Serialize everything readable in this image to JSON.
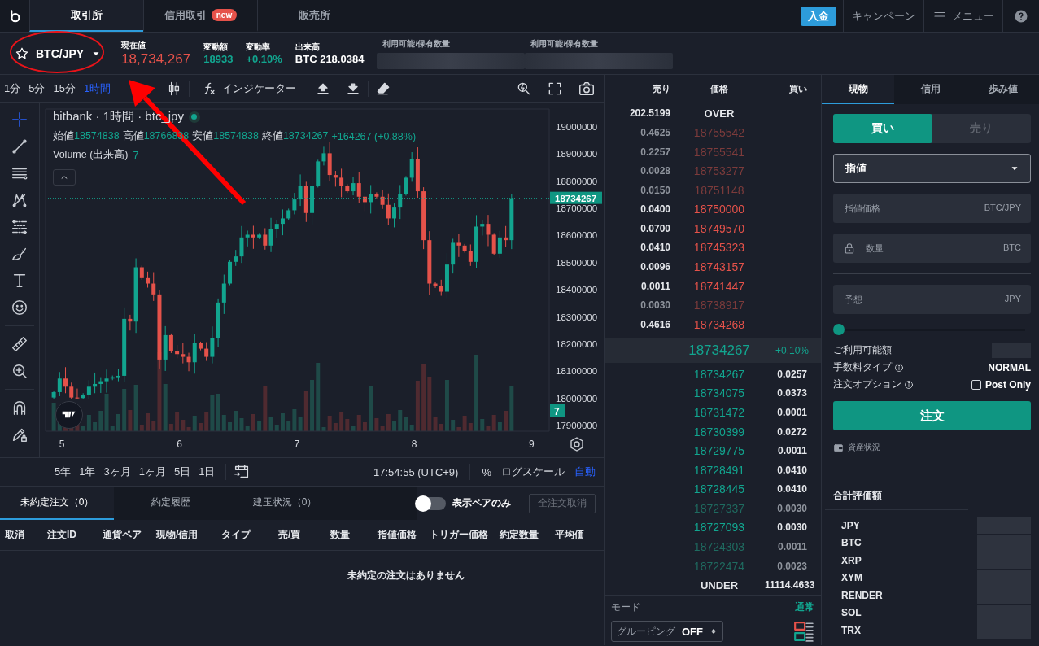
{
  "nav": {
    "tabs": [
      {
        "label": "取引所",
        "selected": true
      },
      {
        "label": "信用取引",
        "badge": "new",
        "selected": false
      },
      {
        "label": "販売所",
        "selected": false
      }
    ],
    "deposit_button": "入金",
    "campaign_link": "キャンペーン",
    "menu_link": "メニュー"
  },
  "ticker": {
    "pair": "BTC/JPY",
    "favorite": false,
    "stats": [
      {
        "label": "現在値",
        "value": "18,734,267",
        "kind": "price"
      },
      {
        "label": "変動額",
        "value": "18933",
        "kind": "up"
      },
      {
        "label": "変動率",
        "value": "+0.10%",
        "kind": "up"
      },
      {
        "label": "出来高",
        "value": "BTC 218.0384",
        "kind": "plain"
      }
    ],
    "balances": [
      "利用可能/保有数量",
      "利用可能/保有数量"
    ]
  },
  "chart": {
    "intervals": [
      {
        "label": "1分",
        "selected": false
      },
      {
        "label": "5分",
        "selected": false
      },
      {
        "label": "15分",
        "selected": false
      },
      {
        "label": "1時間",
        "selected": true
      }
    ],
    "indicator_button": "インジケーター",
    "title": "bitbank · 1時間 · btc_jpy",
    "ohlc": [
      {
        "label": "始値",
        "value": "18574838"
      },
      {
        "label": "高値",
        "value": "18766838"
      },
      {
        "label": "安値",
        "value": "18574838"
      },
      {
        "label": "終値",
        "value": "18734267"
      }
    ],
    "change": "+164267 (+0.88%)",
    "volume_label": "Volume (出来高)",
    "volume_value": "7",
    "chart_data": {
      "type": "candlestick",
      "ylim": [
        17876000,
        19063000
      ],
      "xlim": [
        4.86,
        9.15
      ],
      "ref_lines": [
        {
          "axis": "y",
          "value": 18734267
        }
      ],
      "yticks": [
        19000000,
        18900000,
        18800000,
        18700000,
        18600000,
        18500000,
        18400000,
        18300000,
        18200000,
        18100000,
        18000000,
        17900000
      ],
      "xticks": [
        5,
        6,
        7,
        8,
        9
      ],
      "x": [
        4.93,
        4.98,
        5.03,
        5.08,
        5.13,
        5.18,
        5.23,
        5.28,
        5.33,
        5.38,
        5.43,
        5.48,
        5.53,
        5.58,
        5.63,
        5.68,
        5.73,
        5.78,
        5.83,
        5.88,
        5.93,
        5.98,
        6.03,
        6.08,
        6.13,
        6.18,
        6.23,
        6.28,
        6.33,
        6.38,
        6.43,
        6.48,
        6.53,
        6.58,
        6.63,
        6.68,
        6.73,
        6.78,
        6.83,
        6.88,
        6.93,
        6.98,
        7.03,
        7.08,
        7.13,
        7.18,
        7.23,
        7.28,
        7.33,
        7.38,
        7.43,
        7.48,
        7.53,
        7.58,
        7.63,
        7.68,
        7.73,
        7.78,
        7.83,
        7.88,
        7.93,
        7.98,
        8.03,
        8.08,
        8.13,
        8.18,
        8.23,
        8.28,
        8.33,
        8.38,
        8.43,
        8.48,
        8.53,
        8.58,
        8.63,
        8.68,
        8.73,
        8.78,
        8.83
      ],
      "ohlc": [
        [
          18000000,
          18026000,
          17996000,
          18020000
        ],
        [
          18020000,
          18094000,
          18005000,
          18070000
        ],
        [
          18070000,
          18112000,
          18016000,
          18040000
        ],
        [
          18040000,
          18055000,
          17996000,
          18000000
        ],
        [
          18000000,
          18033000,
          17996000,
          17998000
        ],
        [
          17998000,
          18016000,
          17996000,
          18010000
        ],
        [
          18010000,
          18064000,
          17995000,
          18040000
        ],
        [
          18040000,
          18092000,
          18016000,
          18050000
        ],
        [
          18050000,
          18075000,
          18017000,
          18060000
        ],
        [
          18060000,
          18103000,
          18018000,
          18070000
        ],
        [
          18070000,
          18081000,
          18064000,
          18075000
        ],
        [
          18075000,
          18104000,
          18060000,
          18080000
        ],
        [
          18080000,
          18332000,
          18056000,
          18290000
        ],
        [
          18290000,
          18305000,
          18247000,
          18280000
        ],
        [
          18280000,
          18513000,
          18238000,
          18480000
        ],
        [
          18480000,
          18486000,
          18434000,
          18440000
        ],
        [
          18440000,
          18464000,
          18405000,
          18420000
        ],
        [
          18420000,
          18462000,
          18356000,
          18380000
        ],
        [
          18380000,
          18395000,
          18107000,
          18140000
        ],
        [
          18140000,
          18263000,
          18098000,
          18230000
        ],
        [
          18230000,
          18236000,
          18164000,
          18170000
        ],
        [
          18170000,
          18194000,
          18145000,
          18160000
        ],
        [
          18160000,
          18202000,
          18126000,
          18150000
        ],
        [
          18150000,
          18165000,
          18097000,
          18130000
        ],
        [
          18130000,
          18233000,
          18088000,
          18200000
        ],
        [
          18200000,
          18206000,
          18174000,
          18180000
        ],
        [
          18180000,
          18204000,
          18135000,
          18150000
        ],
        [
          18150000,
          18262000,
          18126000,
          18220000
        ],
        [
          18220000,
          18365000,
          18187000,
          18350000
        ],
        [
          18350000,
          18453000,
          18308000,
          18420000
        ],
        [
          18420000,
          18506000,
          18414000,
          18500000
        ],
        [
          18500000,
          18544000,
          18485000,
          18520000
        ],
        [
          18520000,
          18632000,
          18496000,
          18590000
        ],
        [
          18590000,
          18615000,
          18557000,
          18600000
        ],
        [
          18600000,
          18633000,
          18548000,
          18590000
        ],
        [
          18590000,
          18606000,
          18584000,
          18600000
        ],
        [
          18600000,
          18624000,
          18545000,
          18560000
        ],
        [
          18560000,
          18662000,
          18536000,
          18620000
        ],
        [
          18620000,
          18655000,
          18587000,
          18640000
        ],
        [
          18640000,
          18693000,
          18598000,
          18660000
        ],
        [
          18660000,
          18696000,
          18654000,
          18690000
        ],
        [
          18690000,
          18754000,
          18675000,
          18730000
        ],
        [
          18730000,
          18822000,
          18706000,
          18780000
        ],
        [
          18780000,
          18795000,
          18647000,
          18680000
        ],
        [
          18680000,
          18813000,
          18638000,
          18780000
        ],
        [
          18780000,
          18876000,
          18774000,
          18870000
        ],
        [
          18870000,
          18924000,
          18855000,
          18900000
        ],
        [
          18900000,
          18942000,
          18796000,
          18820000
        ],
        [
          18820000,
          18835000,
          18777000,
          18810000
        ],
        [
          18810000,
          18843000,
          18738000,
          18780000
        ],
        [
          18780000,
          18786000,
          18754000,
          18760000
        ],
        [
          18760000,
          18814000,
          18745000,
          18790000
        ],
        [
          18790000,
          18832000,
          18716000,
          18740000
        ],
        [
          18740000,
          18755000,
          18687000,
          18720000
        ],
        [
          18720000,
          18783000,
          18678000,
          18750000
        ],
        [
          18750000,
          18756000,
          18734000,
          18740000
        ],
        [
          18740000,
          18764000,
          18695000,
          18710000
        ],
        [
          18710000,
          18752000,
          18636000,
          18660000
        ],
        [
          18660000,
          18715000,
          18627000,
          18700000
        ],
        [
          18700000,
          18783000,
          18658000,
          18750000
        ],
        [
          18750000,
          18816000,
          18744000,
          18810000
        ],
        [
          18810000,
          18904000,
          18795000,
          18880000
        ],
        [
          18880000,
          18922000,
          18736000,
          18760000
        ],
        [
          18760000,
          18775000,
          18547000,
          18580000
        ],
        [
          18580000,
          18613000,
          18378000,
          18420000
        ],
        [
          18420000,
          18426000,
          18404000,
          18410000
        ],
        [
          18410000,
          18434000,
          18375000,
          18390000
        ],
        [
          18390000,
          18532000,
          18366000,
          18490000
        ],
        [
          18490000,
          18585000,
          18457000,
          18570000
        ],
        [
          18570000,
          18603000,
          18518000,
          18560000
        ],
        [
          18560000,
          18566000,
          18534000,
          18540000
        ],
        [
          18540000,
          18564000,
          18485000,
          18500000
        ],
        [
          18500000,
          18672000,
          18476000,
          18630000
        ],
        [
          18630000,
          18655000,
          18597000,
          18640000
        ],
        [
          18640000,
          18673000,
          18558000,
          18600000
        ],
        [
          18600000,
          18606000,
          18524000,
          18530000
        ],
        [
          18530000,
          18614000,
          18515000,
          18590000
        ],
        [
          18590000,
          18632000,
          18556000,
          18580000
        ],
        [
          18580000,
          18749000,
          18547000,
          18734267
        ]
      ]
    },
    "last_price": "18734267",
    "volume_badge": "7",
    "ranges": [
      "5年",
      "1年",
      "3ヶ月",
      "1ヶ月",
      "5日",
      "1日"
    ],
    "clock": "17:54:55 (UTC+9)",
    "scale_options": [
      {
        "label": "%",
        "selected": false
      },
      {
        "label": "ログスケール",
        "selected": false
      },
      {
        "label": "自動",
        "selected": true
      }
    ]
  },
  "orderbook": {
    "columns": [
      "売り",
      "価格",
      "買い"
    ],
    "over": {
      "amount": "202.5199",
      "label": "OVER"
    },
    "asks": [
      {
        "amount": "0.4625",
        "price": "18755542",
        "faded": true
      },
      {
        "amount": "0.2257",
        "price": "18755541",
        "faded": true
      },
      {
        "amount": "0.0028",
        "price": "18753277",
        "faded": true
      },
      {
        "amount": "0.0150",
        "price": "18751148",
        "faded": true
      },
      {
        "amount": "0.0400",
        "price": "18750000",
        "faded": false
      },
      {
        "amount": "0.0700",
        "price": "18749570",
        "faded": false
      },
      {
        "amount": "0.0410",
        "price": "18745323",
        "faded": false
      },
      {
        "amount": "0.0096",
        "price": "18743157",
        "faded": false
      },
      {
        "amount": "0.0011",
        "price": "18741447",
        "faded": false
      },
      {
        "amount": "0.0030",
        "price": "18738917",
        "faded": true
      },
      {
        "amount": "0.4616",
        "price": "18734268",
        "faded": false
      }
    ],
    "mid": {
      "price": "18734267",
      "change": "+0.10%"
    },
    "bids": [
      {
        "price": "18734267",
        "amount": "0.0257",
        "faded": false
      },
      {
        "price": "18734075",
        "amount": "0.0373",
        "faded": false
      },
      {
        "price": "18731472",
        "amount": "0.0001",
        "faded": false
      },
      {
        "price": "18730399",
        "amount": "0.0272",
        "faded": false
      },
      {
        "price": "18729775",
        "amount": "0.0011",
        "faded": false
      },
      {
        "price": "18728491",
        "amount": "0.0410",
        "faded": false
      },
      {
        "price": "18728445",
        "amount": "0.0410",
        "faded": false
      },
      {
        "price": "18727337",
        "amount": "0.0030",
        "faded": true
      },
      {
        "price": "18727093",
        "amount": "0.0030",
        "faded": false
      },
      {
        "price": "18724303",
        "amount": "0.0011",
        "faded": true
      },
      {
        "price": "18722474",
        "amount": "0.0023",
        "faded": true
      }
    ],
    "under": {
      "label": "UNDER",
      "amount": "11114.4633"
    },
    "mode_label": "モード",
    "mode_value": "通常",
    "grouping_label": "グルーピング",
    "grouping_value": "OFF"
  },
  "order_form": {
    "tabs": [
      {
        "label": "現物",
        "selected": true
      },
      {
        "label": "信用",
        "selected": false
      },
      {
        "label": "歩み値",
        "selected": false
      }
    ],
    "sides": [
      {
        "label": "買い",
        "selected": true
      },
      {
        "label": "売り",
        "selected": false
      }
    ],
    "order_type": "指値",
    "fields": [
      {
        "placeholder": "指値価格",
        "unit": "BTC/JPY",
        "locked": false
      },
      {
        "placeholder": "数量",
        "unit": "BTC",
        "locked": true
      },
      {
        "placeholder": "予想",
        "unit": "JPY",
        "locked": false
      }
    ],
    "slider": {
      "level": 0
    },
    "info": [
      {
        "label": "ご利用可能額",
        "kind": "hidden"
      },
      {
        "label": "手数料タイプ",
        "kind": "text",
        "value": "NORMAL"
      },
      {
        "label": "注文オプション",
        "kind": "checkbox",
        "value": "Post Only",
        "checked": false
      }
    ],
    "submit": "注文",
    "assets_link": "資産状況",
    "total_label": "合計評価額",
    "assets": [
      "JPY",
      "BTC",
      "XRP",
      "XYM",
      "RENDER",
      "SOL",
      "TRX"
    ]
  },
  "orders": {
    "tabs": [
      {
        "label": "未約定注文（0）",
        "selected": true
      },
      {
        "label": "約定履歴",
        "selected": false
      },
      {
        "label": "建玉状況（0）",
        "selected": false
      }
    ],
    "toggle": {
      "label": "表示ペアのみ",
      "on": false
    },
    "cancel_all": {
      "label": "全注文取消",
      "disabled": true
    },
    "columns": [
      "取消",
      "注文ID",
      "通貨ペア",
      "現物/信用",
      "タイプ",
      "売/買",
      "数量",
      "指値価格",
      "トリガー価格",
      "約定数量",
      "平均価"
    ],
    "empty": "未約定の注文はありません"
  }
}
